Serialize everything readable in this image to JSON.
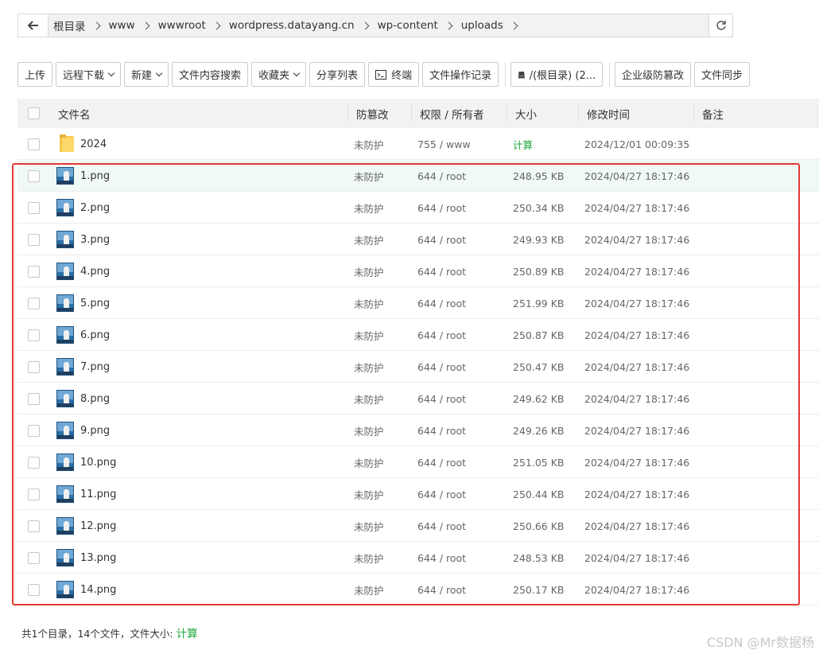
{
  "breadcrumb": {
    "items": [
      "根目录",
      "www",
      "wwwroot",
      "wordpress.datayang.cn",
      "wp-content",
      "uploads"
    ]
  },
  "toolbar": {
    "upload": "上传",
    "remote_download": "远程下载",
    "new": "新建",
    "content_search": "文件内容搜索",
    "favorites": "收藏夹",
    "share_list": "分享列表",
    "terminal": "终端",
    "operation_log": "文件操作记录",
    "disk": "/(根目录) (2...",
    "tamper_proof": "企业级防篡改",
    "file_sync": "文件同步"
  },
  "table": {
    "headers": {
      "name": "文件名",
      "protect": "防篡改",
      "perm": "权限 / 所有者",
      "size": "大小",
      "mtime": "修改时间",
      "note": "备注"
    },
    "rows": [
      {
        "name": "2024",
        "protect": "未防护",
        "perm": "755 / www",
        "size": "计算",
        "mtime": "2024/12/01 00:09:35"
      },
      {
        "name": "1.png",
        "protect": "未防护",
        "perm": "644 / root",
        "size": "248.95 KB",
        "mtime": "2024/04/27 18:17:46"
      },
      {
        "name": "2.png",
        "protect": "未防护",
        "perm": "644 / root",
        "size": "250.34 KB",
        "mtime": "2024/04/27 18:17:46"
      },
      {
        "name": "3.png",
        "protect": "未防护",
        "perm": "644 / root",
        "size": "249.93 KB",
        "mtime": "2024/04/27 18:17:46"
      },
      {
        "name": "4.png",
        "protect": "未防护",
        "perm": "644 / root",
        "size": "250.89 KB",
        "mtime": "2024/04/27 18:17:46"
      },
      {
        "name": "5.png",
        "protect": "未防护",
        "perm": "644 / root",
        "size": "251.99 KB",
        "mtime": "2024/04/27 18:17:46"
      },
      {
        "name": "6.png",
        "protect": "未防护",
        "perm": "644 / root",
        "size": "250.87 KB",
        "mtime": "2024/04/27 18:17:46"
      },
      {
        "name": "7.png",
        "protect": "未防护",
        "perm": "644 / root",
        "size": "250.47 KB",
        "mtime": "2024/04/27 18:17:46"
      },
      {
        "name": "8.png",
        "protect": "未防护",
        "perm": "644 / root",
        "size": "249.62 KB",
        "mtime": "2024/04/27 18:17:46"
      },
      {
        "name": "9.png",
        "protect": "未防护",
        "perm": "644 / root",
        "size": "249.26 KB",
        "mtime": "2024/04/27 18:17:46"
      },
      {
        "name": "10.png",
        "protect": "未防护",
        "perm": "644 / root",
        "size": "251.05 KB",
        "mtime": "2024/04/27 18:17:46"
      },
      {
        "name": "11.png",
        "protect": "未防护",
        "perm": "644 / root",
        "size": "250.44 KB",
        "mtime": "2024/04/27 18:17:46"
      },
      {
        "name": "12.png",
        "protect": "未防护",
        "perm": "644 / root",
        "size": "250.66 KB",
        "mtime": "2024/04/27 18:17:46"
      },
      {
        "name": "13.png",
        "protect": "未防护",
        "perm": "644 / root",
        "size": "248.53 KB",
        "mtime": "2024/04/27 18:17:46"
      },
      {
        "name": "14.png",
        "protect": "未防护",
        "perm": "644 / root",
        "size": "250.17 KB",
        "mtime": "2024/04/27 18:17:46"
      }
    ]
  },
  "footer": {
    "summary": "共1个目录，14个文件，文件大小:",
    "calc": "计算"
  },
  "watermark": "CSDN @Mr数据杨",
  "colors": {
    "accent_green": "#20a53a",
    "highlight_border": "#e53935",
    "row_highlight": "#f0f9f4"
  }
}
